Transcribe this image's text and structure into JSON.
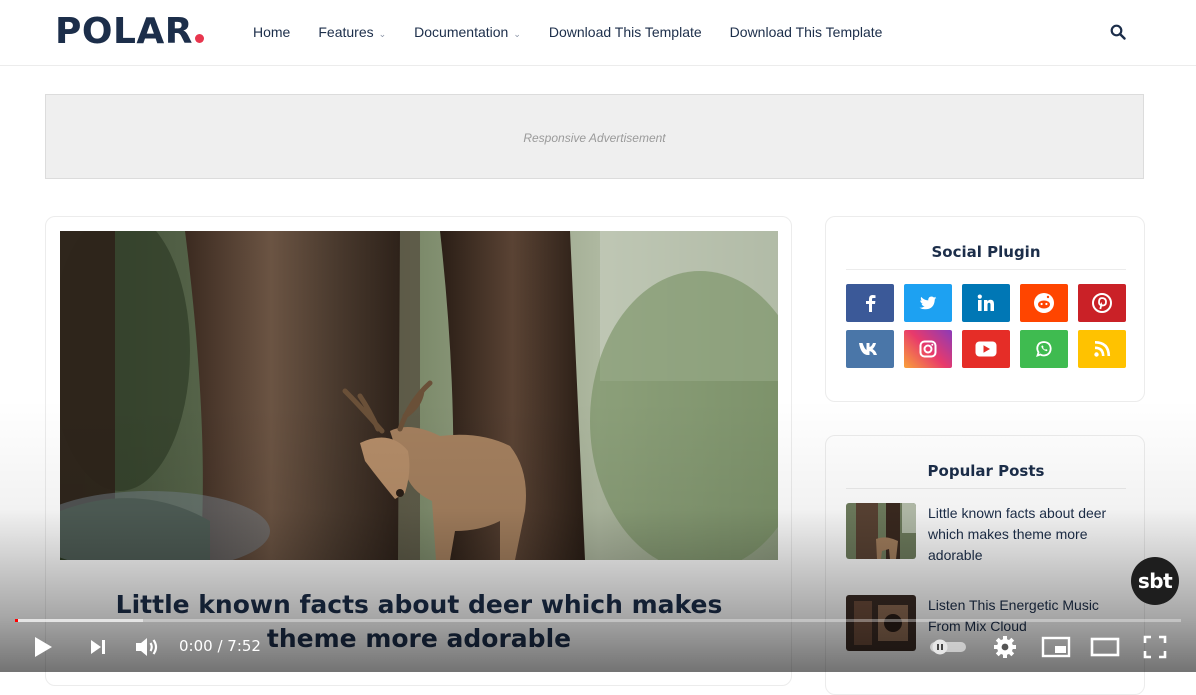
{
  "header": {
    "logo_text": "POLAR",
    "nav": [
      {
        "label": "Home",
        "has_dropdown": false
      },
      {
        "label": "Features",
        "has_dropdown": true
      },
      {
        "label": "Documentation",
        "has_dropdown": true
      },
      {
        "label": "Download This Template",
        "has_dropdown": false
      },
      {
        "label": "Download This Template",
        "has_dropdown": false
      }
    ],
    "search_icon": "search-icon"
  },
  "ad": {
    "label": "Responsive Advertisement"
  },
  "post": {
    "title": "Little known facts about deer which makes theme more adorable",
    "image": "deer-in-forest-photo"
  },
  "sidebar": {
    "social": {
      "title": "Social Plugin",
      "buttons": [
        {
          "name": "facebook",
          "icon": "facebook-icon",
          "color": "#3b5998"
        },
        {
          "name": "twitter",
          "icon": "twitter-icon",
          "color": "#1da1f2"
        },
        {
          "name": "linkedin",
          "icon": "linkedin-icon",
          "color": "#0077b5"
        },
        {
          "name": "reddit",
          "icon": "reddit-icon",
          "color": "#ff4500"
        },
        {
          "name": "pinterest",
          "icon": "pinterest-icon",
          "color": "#ca2127"
        },
        {
          "name": "vk",
          "icon": "vk-icon",
          "color": "#4a76a8"
        },
        {
          "name": "instagram",
          "icon": "instagram-icon",
          "color": "#c13584"
        },
        {
          "name": "youtube",
          "icon": "youtube-icon",
          "color": "#e52d27"
        },
        {
          "name": "whatsapp",
          "icon": "whatsapp-icon",
          "color": "#3fbb50"
        },
        {
          "name": "rss",
          "icon": "rss-icon",
          "color": "#ffc200"
        }
      ]
    },
    "popular": {
      "title": "Popular Posts",
      "posts": [
        {
          "title": "Little known facts about deer which makes theme more adorable"
        },
        {
          "title": "Listen This Energetic Music From Mix Cloud"
        }
      ]
    }
  },
  "video": {
    "current_time": "0:00",
    "duration": "7:52",
    "time_label": "0:00 / 7:52",
    "progress": 0,
    "buffered": 0.11,
    "watermark": "sbt",
    "accent_color": "#ff0000"
  }
}
